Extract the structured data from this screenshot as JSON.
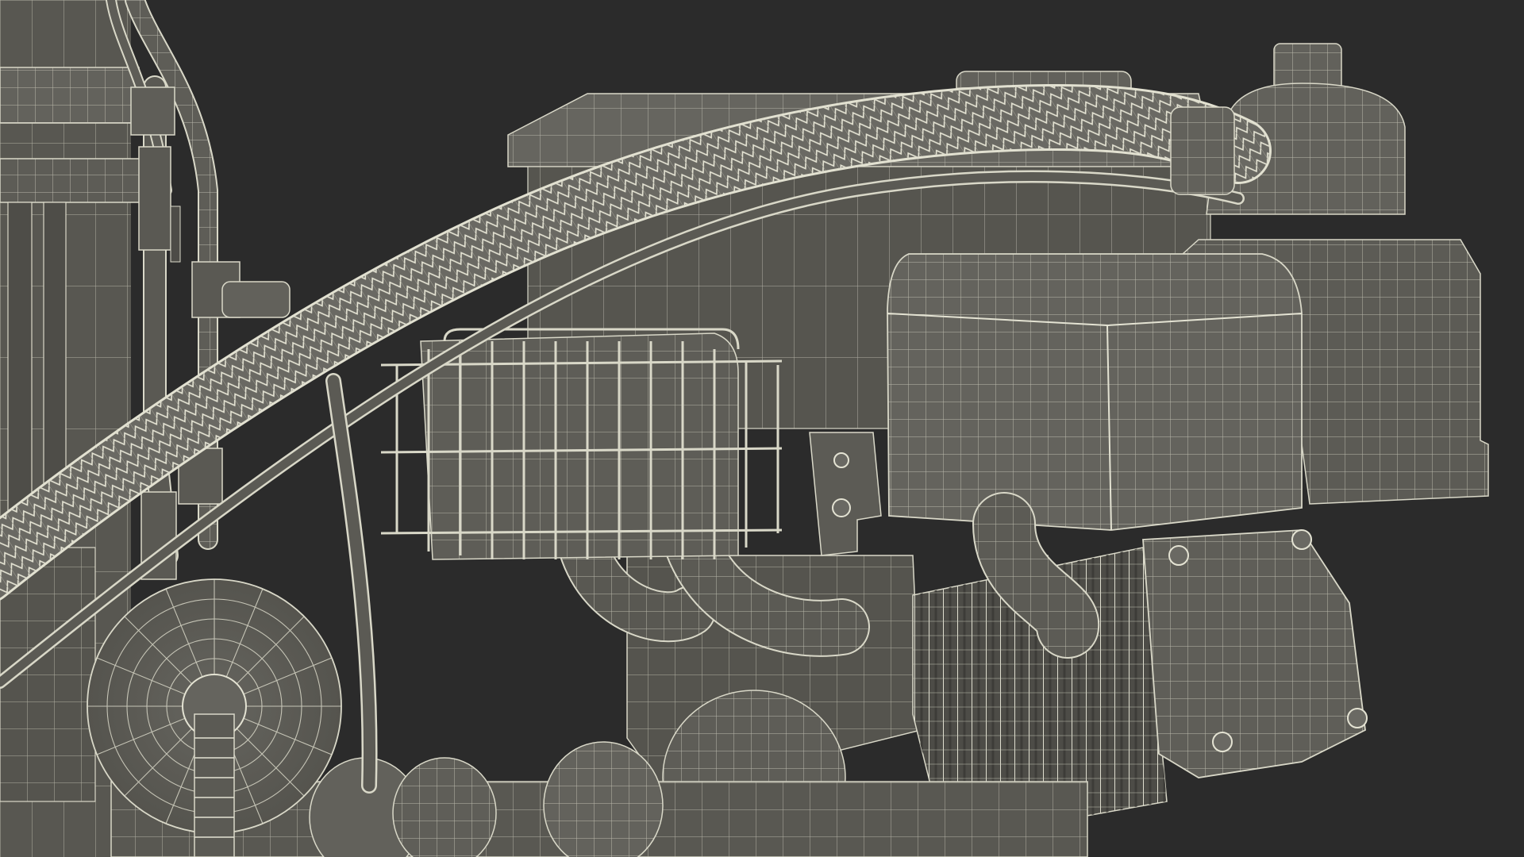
{
  "scene": {
    "subject": "wireframe-render",
    "background_color": "#2b2b2b",
    "surface_color": "#5f5e58",
    "surface_dark_color": "#4a4944",
    "wire_color": "#d9d8c8"
  }
}
